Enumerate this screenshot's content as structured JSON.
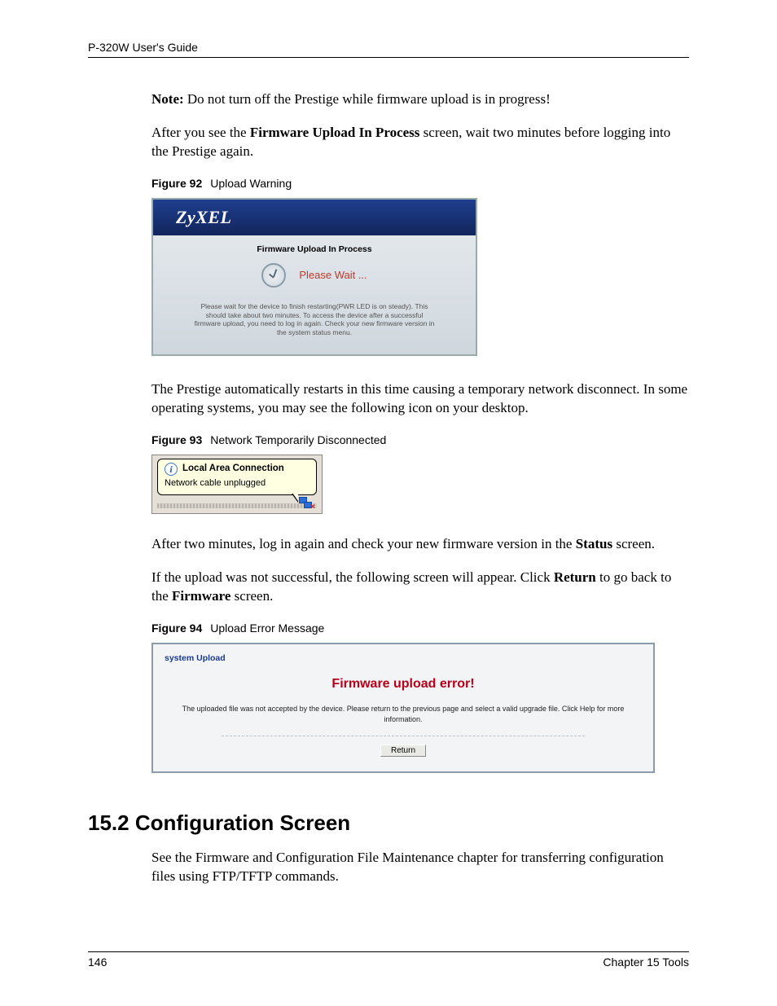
{
  "header": {
    "guide": "P-320W User's Guide"
  },
  "note": {
    "label": "Note:",
    "text": " Do not turn off the Prestige while firmware upload is in progress!"
  },
  "para_after_note": {
    "pre": "After you see the ",
    "bold": "Firmware Upload In Process",
    "post": " screen, wait two minutes before logging into the Prestige again."
  },
  "fig92": {
    "caption_label": "Figure 92",
    "caption_text": "Upload Warning",
    "brand": "ZyXEL",
    "title": "Firmware Upload In Process",
    "wait": "Please Wait ...",
    "msg": "Please wait for the device to finish restarting(PWR LED is on steady). This should take about two minutes. To access the device after a successful firmware upload, you need to log in again. Check your new firmware version in the system status menu."
  },
  "para_restart": "The Prestige automatically restarts in this time causing a temporary network disconnect. In some operating systems, you may see the following icon on your desktop.",
  "fig93": {
    "caption_label": "Figure 93",
    "caption_text": "Network Temporarily Disconnected",
    "title": "Local Area Connection",
    "body": "Network cable unplugged",
    "info_glyph": "i"
  },
  "para_two_min": {
    "pre": "After two minutes, log in again and check your new firmware version in the ",
    "bold": "Status",
    "post": " screen."
  },
  "para_fail": {
    "pre": "If the upload was not successful, the following screen will appear. Click ",
    "bold1": "Return",
    "mid": " to go back to the ",
    "bold2": "Firmware",
    "post": " screen."
  },
  "fig94": {
    "caption_label": "Figure 94",
    "caption_text": "Upload Error Message",
    "crumb": "system Upload",
    "error": "Firmware upload error!",
    "msg": "The uploaded file was not accepted by the device. Please return to the previous page and select a valid upgrade file. Click Help for more information.",
    "button": "Return"
  },
  "section": {
    "heading": "15.2  Configuration Screen",
    "body": "See the Firmware and Configuration File Maintenance chapter for transferring configuration files using FTP/TFTP commands."
  },
  "footer": {
    "page": "146",
    "chapter": "Chapter 15 Tools"
  }
}
